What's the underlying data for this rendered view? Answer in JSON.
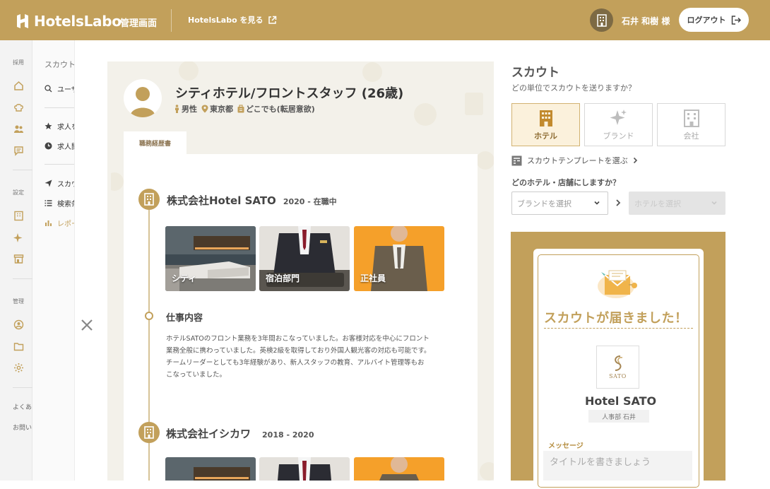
{
  "header": {
    "logo_text": "HotelsLabo",
    "admin_label": "管理画面",
    "view_site_label": "HotelsLabo を見る",
    "user_name": "石井 和樹 様",
    "logout_label": "ログアウト"
  },
  "sidebar": {
    "sections": [
      {
        "label": "採用",
        "icons": [
          "home-icon",
          "chef-hat-icon",
          "users-icon",
          "message-icon"
        ]
      },
      {
        "label": "設定",
        "icons": [
          "building-icon",
          "sparkle-icon",
          "store-icon"
        ]
      },
      {
        "label": "管理",
        "icons": [
          "account-icon",
          "folder-icon",
          "gear-icon"
        ]
      }
    ],
    "footer": [
      "よくあ",
      "お問い"
    ]
  },
  "subnav": {
    "title": "スカウト",
    "items": [
      "ユーザー",
      "求人を",
      "求人閲",
      "スカウト",
      "検索条",
      "レポート"
    ]
  },
  "candidate": {
    "title": "シティホテル/フロントスタッフ (26歳)",
    "gender": "男性",
    "location": "東京都",
    "relocation": "どこでも(転居意欲)",
    "tab_label": "職務経歴書",
    "careers": [
      {
        "company": "株式会社Hotel SATO",
        "period": "2020 - 在職中",
        "photos": [
          {
            "label": "シティ",
            "kind": "room"
          },
          {
            "label": "宿泊部門",
            "kind": "staff"
          },
          {
            "label": "正社員",
            "kind": "suit"
          }
        ]
      },
      {
        "company": "株式会社イシカワ",
        "period": "2018 - 2020",
        "photos": [
          {
            "label": "",
            "kind": "room"
          },
          {
            "label": "",
            "kind": "staff"
          },
          {
            "label": "",
            "kind": "suit"
          }
        ]
      }
    ],
    "job_heading": "仕事内容",
    "job_body": "ホテルSATOのフロント業務を3年間おこなっていました。お客様対応を中心にフロント業務全般に携わっていました。英検2級を取得しており外国人観光客の対応も可能です。チームリーダーとしても3年経験があり、新人スタッフの教育、アルバイト管理等もおこなっていました。"
  },
  "scout": {
    "title": "スカウト",
    "subtitle": "どの単位でスカウトを送りますか？",
    "units": [
      {
        "label": "ホテル",
        "active": true,
        "icon": "hotel-icon"
      },
      {
        "label": "ブランド",
        "active": false,
        "icon": "sparkle-icon"
      },
      {
        "label": "会社",
        "active": false,
        "icon": "company-icon"
      }
    ],
    "template_link": "スカウトテンプレートを選ぶ",
    "hotel_question": "どのホテル・店舗にしますか？",
    "brand_placeholder": "ブランドを選択",
    "hotel_placeholder": "ホテルを選択"
  },
  "preview": {
    "heading": "スカウトが届きました！",
    "brand_logo_text": "SATO",
    "hotel_name": "Hotel SATO",
    "department": "人事部 石井",
    "message_label": "メッセージ",
    "message_placeholder": "タイトルを書きましょう"
  },
  "colors": {
    "brand_gold": "#c2a05b",
    "active_unit_bg": "#fbf1dc",
    "photo_orange": "#f5a02a"
  }
}
